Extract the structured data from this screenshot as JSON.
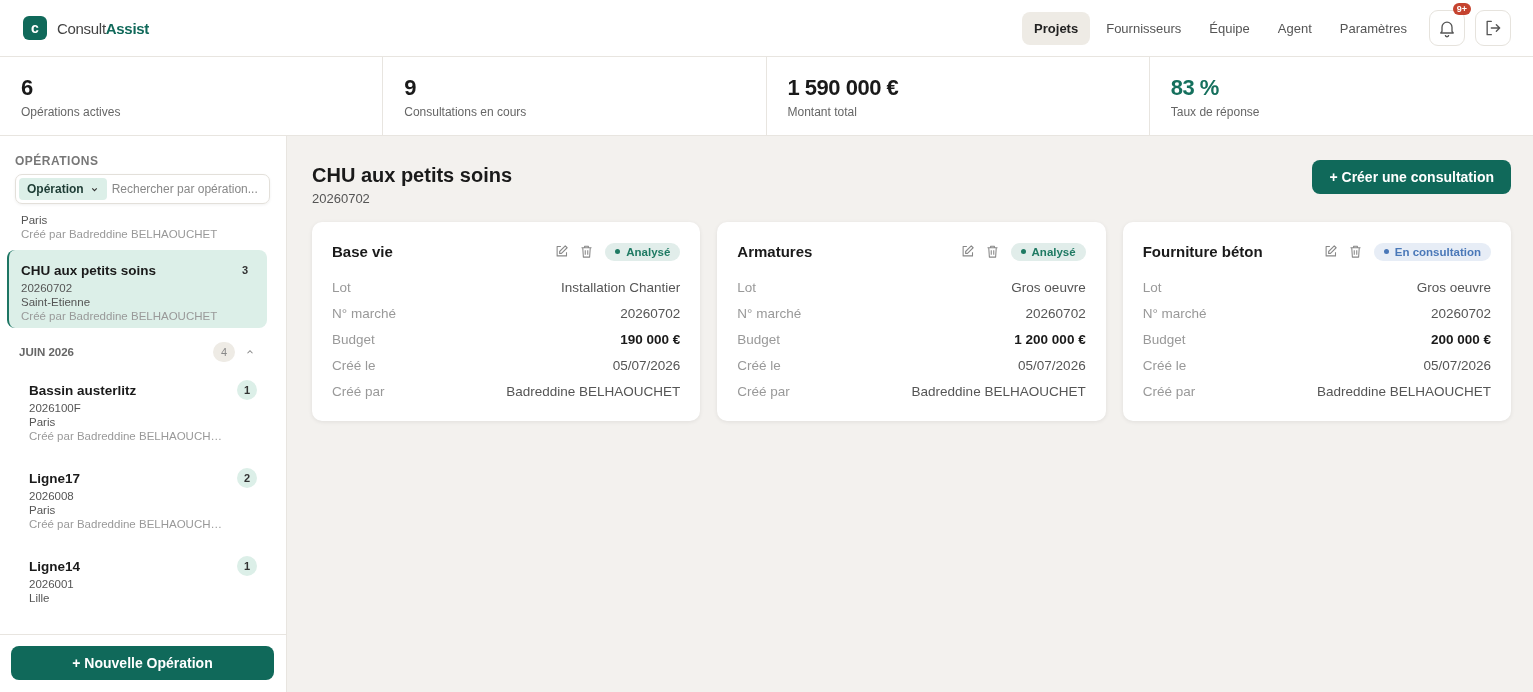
{
  "app": {
    "logo_letter": "c",
    "name_part1": "Consult",
    "name_part2": "Assist"
  },
  "nav": [
    {
      "label": "Projets",
      "selected": true
    },
    {
      "label": "Fournisseurs",
      "selected": false
    },
    {
      "label": "Équipe",
      "selected": false
    },
    {
      "label": "Agent",
      "selected": false
    },
    {
      "label": "Paramètres",
      "selected": false
    }
  ],
  "notifications": {
    "badge": "9+"
  },
  "stats": [
    {
      "value": "6",
      "label": "Opérations actives",
      "accent": false
    },
    {
      "value": "9",
      "label": "Consultations en cours",
      "accent": false
    },
    {
      "value": "1 590 000 €",
      "label": "Montant total",
      "accent": false
    },
    {
      "value": "83 %",
      "label": "Taux de réponse",
      "accent": true
    }
  ],
  "sidebar": {
    "title": "OPÉRATIONS",
    "filter": "Opération",
    "search": {
      "placeholder": "Rechercher par opération..."
    },
    "items": [
      {
        "kind": "operation",
        "city": "Paris",
        "creator": "Créé par Badreddine BELHAOUCHET",
        "selected": false
      },
      {
        "kind": "operation",
        "name": "CHU aux petits soins",
        "count": "3",
        "code": "20260702",
        "city": "Saint-Etienne",
        "creator": "Créé par Badreddine BELHAOUCHET",
        "selected": true
      },
      {
        "kind": "group",
        "label": "JUIN 2026",
        "count": "4",
        "expanded": true,
        "children": [
          {
            "kind": "operation",
            "name": "Bassin austerlitz",
            "count": "1",
            "code": "2026100F",
            "city": "Paris",
            "creator": "Créé par Badreddine BELHAOUCH…",
            "selected": false
          },
          {
            "kind": "operation",
            "name": "Ligne17",
            "count": "2",
            "code": "2026008",
            "city": "Paris",
            "creator": "Créé par Badreddine BELHAOUCH…",
            "selected": false
          },
          {
            "kind": "operation",
            "name": "Ligne14",
            "count": "1",
            "code": "2026001",
            "city": "Lille",
            "selected": false
          }
        ]
      }
    ],
    "new_button": "+ Nouvelle Opération"
  },
  "main": {
    "title": "CHU aux petits soins",
    "subtitle": "20260702",
    "create_button": "+ Créer une consultation",
    "cards": [
      {
        "title": "Base vie",
        "status": {
          "label": "Analysé",
          "color": "#1f7a63"
        },
        "fields": [
          {
            "label": "Lot",
            "value": "Installation Chantier",
            "bold": false
          },
          {
            "label": "N° marché",
            "value": "20260702",
            "bold": false
          },
          {
            "label": "Budget",
            "value": "190 000 €",
            "bold": true
          },
          {
            "label": "Créé le",
            "value": "05/07/2026",
            "bold": false
          },
          {
            "label": "Créé par",
            "value": "Badreddine BELHAOUCHET",
            "bold": false
          }
        ]
      },
      {
        "title": "Armatures",
        "status": {
          "label": "Analysé",
          "color": "#1f7a63"
        },
        "fields": [
          {
            "label": "Lot",
            "value": "Gros oeuvre",
            "bold": false
          },
          {
            "label": "N° marché",
            "value": "20260702",
            "bold": false
          },
          {
            "label": "Budget",
            "value": "1 200 000 €",
            "bold": true
          },
          {
            "label": "Créé le",
            "value": "05/07/2026",
            "bold": false
          },
          {
            "label": "Créé par",
            "value": "Badreddine BELHAOUCHET",
            "bold": false
          }
        ]
      },
      {
        "title": "Fourniture béton",
        "status": {
          "label": "En consultation",
          "color": "#4a78b8"
        },
        "fields": [
          {
            "label": "Lot",
            "value": "Gros oeuvre",
            "bold": false
          },
          {
            "label": "N° marché",
            "value": "20260702",
            "bold": false
          },
          {
            "label": "Budget",
            "value": "200 000 €",
            "bold": true
          },
          {
            "label": "Créé le",
            "value": "05/07/2026",
            "bold": false
          },
          {
            "label": "Créé par",
            "value": "Badreddine BELHAOUCHET",
            "bold": false
          }
        ]
      }
    ]
  }
}
